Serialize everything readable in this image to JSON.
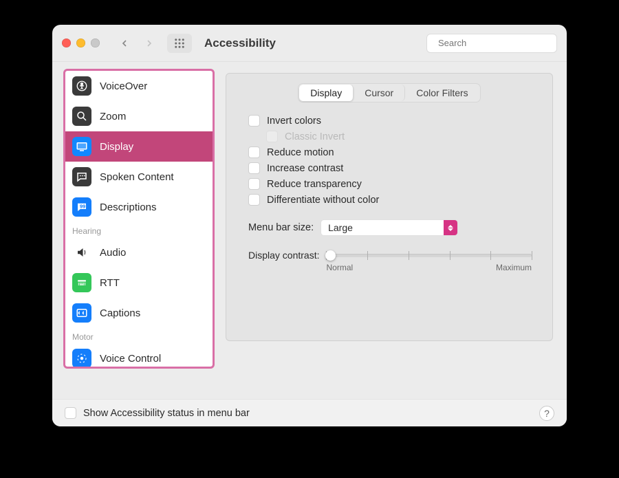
{
  "header": {
    "title": "Accessibility",
    "search_placeholder": "Search"
  },
  "sidebar": {
    "vision": [
      "VoiceOver",
      "Zoom",
      "Display",
      "Spoken Content",
      "Descriptions"
    ],
    "hearing_label": "Hearing",
    "hearing": [
      "Audio",
      "RTT",
      "Captions"
    ],
    "motor_label": "Motor",
    "motor": [
      "Voice Control"
    ]
  },
  "tabs": [
    "Display",
    "Cursor",
    "Color Filters"
  ],
  "options": [
    "Invert colors",
    "Classic Invert",
    "Reduce motion",
    "Increase contrast",
    "Reduce transparency",
    "Differentiate without color"
  ],
  "menu_bar": {
    "label": "Menu bar size:",
    "value": "Large"
  },
  "contrast": {
    "label": "Display contrast:",
    "min": "Normal",
    "max": "Maximum"
  },
  "footer": {
    "show_status": "Show Accessibility status in menu bar"
  }
}
